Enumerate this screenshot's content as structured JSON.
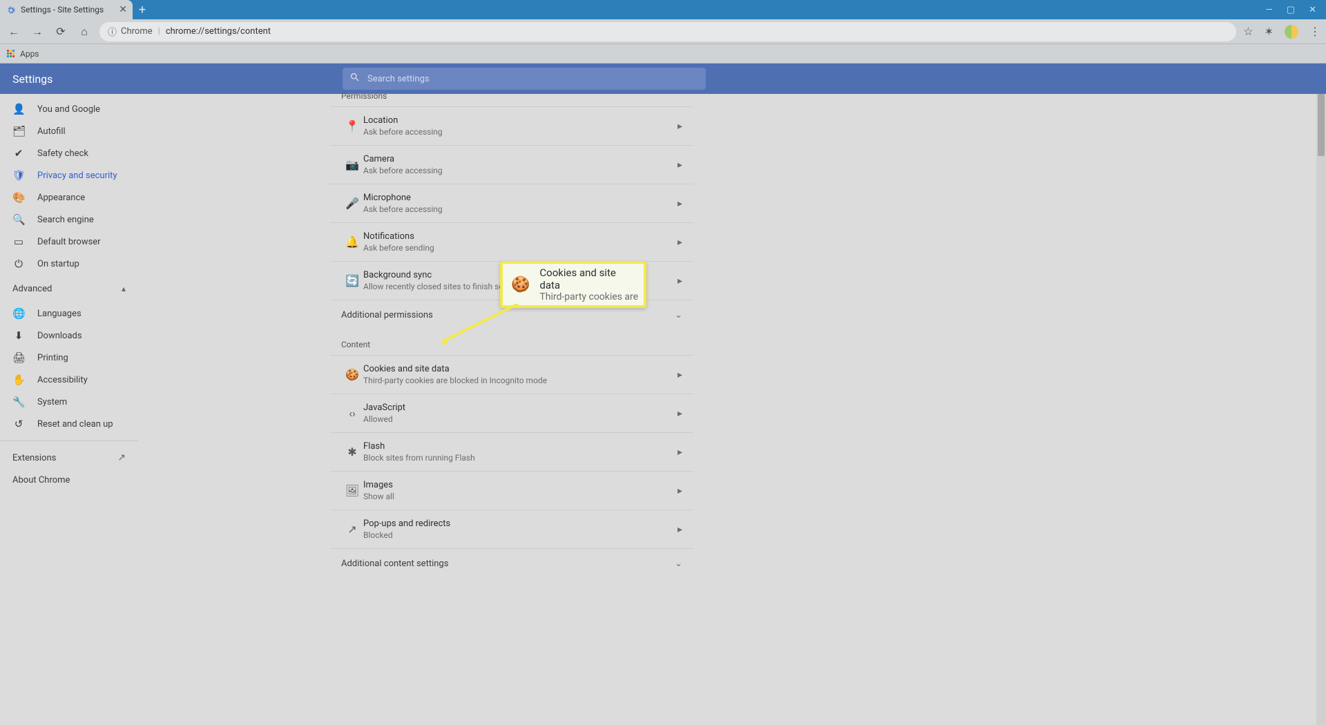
{
  "browser": {
    "tab_title": "Settings - Site Settings",
    "new_tab_glyph": "+",
    "win": {
      "min": "—",
      "max": "▢",
      "close": "✕"
    },
    "omnibox": {
      "scheme_label": "Chrome",
      "url": "chrome://settings/content"
    },
    "bookmarks": {
      "apps": "Apps"
    }
  },
  "header": {
    "title": "Settings",
    "search_placeholder": "Search settings"
  },
  "sidebar": {
    "items": [
      {
        "icon": "👤",
        "label": "You and Google"
      },
      {
        "icon": "🗂",
        "label": "Autofill"
      },
      {
        "icon": "✔",
        "label": "Safety check"
      },
      {
        "icon": "🛡",
        "label": "Privacy and security"
      },
      {
        "icon": "🎨",
        "label": "Appearance"
      },
      {
        "icon": "🔍",
        "label": "Search engine"
      },
      {
        "icon": "▭",
        "label": "Default browser"
      },
      {
        "icon": "⏻",
        "label": "On startup"
      }
    ],
    "advanced_label": "Advanced",
    "advanced_items": [
      {
        "icon": "🌐",
        "label": "Languages"
      },
      {
        "icon": "⬇",
        "label": "Downloads"
      },
      {
        "icon": "🖨",
        "label": "Printing"
      },
      {
        "icon": "✋",
        "label": "Accessibility"
      },
      {
        "icon": "🔧",
        "label": "System"
      },
      {
        "icon": "↺",
        "label": "Reset and clean up"
      }
    ],
    "extensions_label": "Extensions",
    "about_label": "About Chrome"
  },
  "main": {
    "permissions_title": "Permissions",
    "permissions": [
      {
        "icon": "📍",
        "title": "Location",
        "sub": "Ask before accessing"
      },
      {
        "icon": "📷",
        "title": "Camera",
        "sub": "Ask before accessing"
      },
      {
        "icon": "🎤",
        "title": "Microphone",
        "sub": "Ask before accessing"
      },
      {
        "icon": "🔔",
        "title": "Notifications",
        "sub": "Ask before sending"
      },
      {
        "icon": "🔄",
        "title": "Background sync",
        "sub": "Allow recently closed sites to finish sending and receiving data"
      }
    ],
    "additional_permissions": "Additional permissions",
    "content_title": "Content",
    "content": [
      {
        "icon": "🍪",
        "title": "Cookies and site data",
        "sub": "Third-party cookies are blocked in Incognito mode"
      },
      {
        "icon": "‹›",
        "title": "JavaScript",
        "sub": "Allowed"
      },
      {
        "icon": "✱",
        "title": "Flash",
        "sub": "Block sites from running Flash"
      },
      {
        "icon": "🖼",
        "title": "Images",
        "sub": "Show all"
      },
      {
        "icon": "↗",
        "title": "Pop-ups and redirects",
        "sub": "Blocked"
      }
    ],
    "additional_content": "Additional content settings"
  },
  "callout": {
    "icon": "🍪",
    "title": "Cookies and site data",
    "sub": "Third-party cookies are"
  }
}
